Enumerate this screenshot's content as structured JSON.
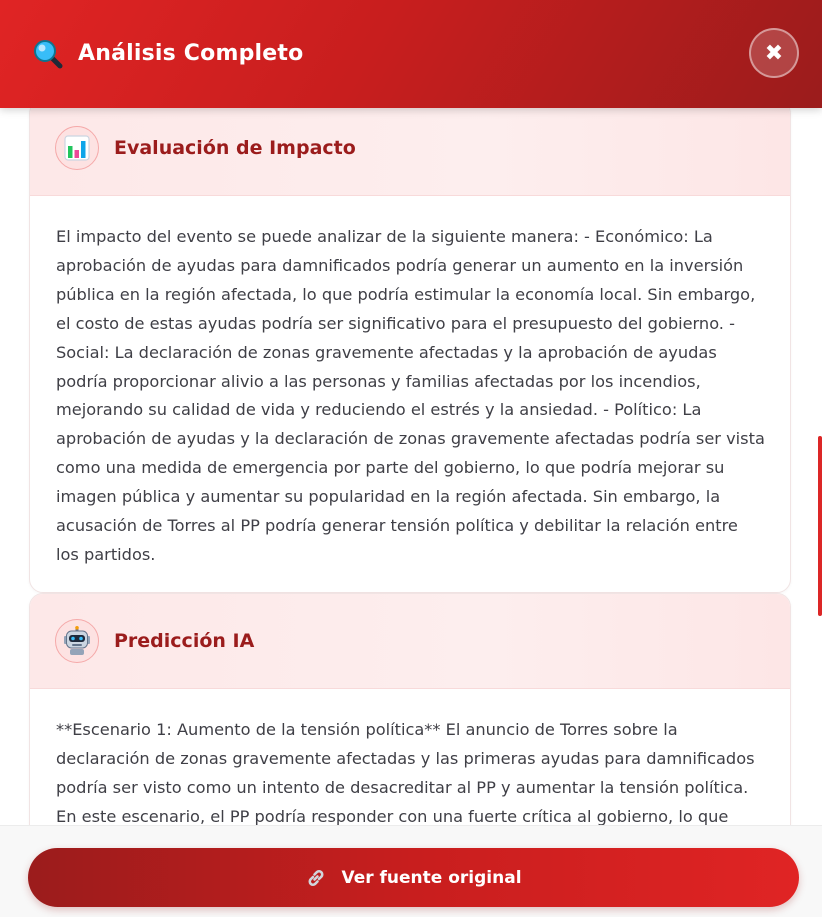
{
  "modal": {
    "title": "Análisis Completo",
    "close_label": "✖"
  },
  "cards": [
    {
      "title": "Evaluación de Impacto",
      "icon": "bar-chart-icon",
      "body": "El impacto del evento se puede analizar de la siguiente manera: - Económico: La aprobación de ayudas para damnificados podría generar un aumento en la inversión pública en la región afectada, lo que podría estimular la economía local. Sin embargo, el costo de estas ayudas podría ser significativo para el presupuesto del gobierno. - Social: La declaración de zonas gravemente afectadas y la aprobación de ayudas podría proporcionar alivio a las personas y familias afectadas por los incendios, mejorando su calidad de vida y reduciendo el estrés y la ansiedad. - Político: La aprobación de ayudas y la declaración de zonas gravemente afectadas podría ser vista como una medida de emergencia por parte del gobierno, lo que podría mejorar su imagen pública y aumentar su popularidad en la región afectada. Sin embargo, la acusación de Torres al PP podría generar tensión política y debilitar la relación entre los partidos."
    },
    {
      "title": "Predicción IA",
      "icon": "robot-icon",
      "body": "**Escenario 1: Aumento de la tensión política** El anuncio de Torres sobre la declaración de zonas gravemente afectadas y las primeras ayudas para damnificados podría ser visto como un intento de desacreditar al PP y aumentar la tensión política. En este escenario, el PP podría responder con una fuerte crítica al gobierno, lo que podría llevar a un"
    }
  ],
  "footer": {
    "source_button_label": "Ver fuente original"
  },
  "colors": {
    "accent": "#c81e1e",
    "accent_dark": "#9b1c1c",
    "card_header_bg": "#fde8e8"
  }
}
